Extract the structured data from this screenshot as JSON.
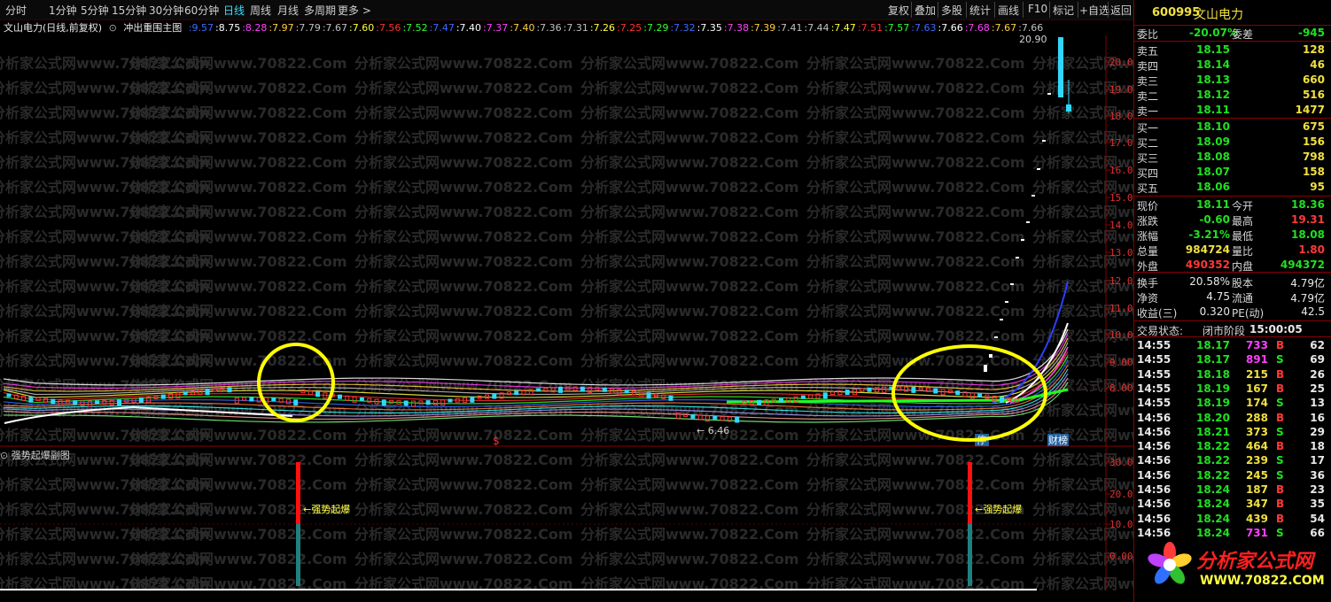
{
  "toolbar": {
    "periods": [
      "分时",
      "1分钟",
      "5分钟",
      "15分钟",
      "30分钟",
      "60分钟",
      "日线",
      "周线",
      "月线",
      "多周期",
      "更多 >"
    ],
    "active_period": "日线",
    "tools": [
      "复权",
      "叠加",
      "多股",
      "统计",
      "画线",
      "F10",
      "标记",
      "+自选",
      "返回"
    ]
  },
  "chart": {
    "stock_label": "文山电力(日线,前复权)",
    "main_indicator": "冲出重围主图",
    "ma_values": [
      {
        "v": "9.57",
        "c": "#3a6cff"
      },
      {
        "v": "8.75",
        "c": "#ffffff"
      },
      {
        "v": "8.28",
        "c": "#ff40ff"
      },
      {
        "v": "7.97",
        "c": "#ffd040"
      },
      {
        "v": "7.79",
        "c": "#c0c0c0"
      },
      {
        "v": "7.67",
        "c": "#c0c0c0"
      },
      {
        "v": "7.60",
        "c": "#ffff40"
      },
      {
        "v": "7.56",
        "c": "#ff3030"
      },
      {
        "v": "7.52",
        "c": "#30ff30"
      },
      {
        "v": "7.47",
        "c": "#3a6cff"
      },
      {
        "v": "7.40",
        "c": "#ffffff"
      },
      {
        "v": "7.37",
        "c": "#ff40ff"
      },
      {
        "v": "7.40",
        "c": "#ffd040"
      },
      {
        "v": "7.36",
        "c": "#c0c0c0"
      },
      {
        "v": "7.31",
        "c": "#c0c0c0"
      },
      {
        "v": "7.26",
        "c": "#ffff40"
      },
      {
        "v": "7.25",
        "c": "#ff3030"
      },
      {
        "v": "7.29",
        "c": "#30ff30"
      },
      {
        "v": "7.32",
        "c": "#3a6cff"
      },
      {
        "v": "7.35",
        "c": "#ffffff"
      },
      {
        "v": "7.38",
        "c": "#ff40ff"
      },
      {
        "v": "7.39",
        "c": "#ffd040"
      },
      {
        "v": "7.41",
        "c": "#c0c0c0"
      },
      {
        "v": "7.44",
        "c": "#c0c0c0"
      },
      {
        "v": "7.47",
        "c": "#ffff40"
      },
      {
        "v": "7.51",
        "c": "#ff3030"
      },
      {
        "v": "7.57",
        "c": "#30ff30"
      },
      {
        "v": "7.63",
        "c": "#3a6cff"
      },
      {
        "v": "7.66",
        "c": "#ffffff"
      },
      {
        "v": "7.68",
        "c": "#ff40ff"
      },
      {
        "v": "7.67",
        "c": "#ffd040"
      },
      {
        "v": "7.66",
        "c": "#c0c0c0"
      }
    ],
    "y_ticks": [
      "20.00",
      "19.00",
      "18.00",
      "17.00",
      "16.00",
      "15.00",
      "14.00",
      "13.00",
      "12.00",
      "11.00",
      "10.00",
      "9.00",
      "8.00"
    ],
    "high_label": "20.90",
    "low_label": "← 6.46",
    "marker_s": "$",
    "badge_left": "停",
    "badge_right": "财榜",
    "watermark": "分析家公式网www.70822.Com"
  },
  "sub_chart": {
    "title": "强势起爆副图",
    "y_ticks": [
      "30.00",
      "20.00",
      "10.00",
      "0.00"
    ],
    "signal_label": "←强势起爆"
  },
  "panel": {
    "code": "600995",
    "name": "文山电力",
    "weibi_label": "委比",
    "weibi_value": "-20.07%",
    "weicha_label": "委差",
    "weicha_value": "-945",
    "sells": [
      {
        "label": "卖五",
        "price": "18.15",
        "vol": "128"
      },
      {
        "label": "卖四",
        "price": "18.14",
        "vol": "46"
      },
      {
        "label": "卖三",
        "price": "18.13",
        "vol": "660"
      },
      {
        "label": "卖二",
        "price": "18.12",
        "vol": "516"
      },
      {
        "label": "卖一",
        "price": "18.11",
        "vol": "1477"
      }
    ],
    "buys": [
      {
        "label": "买一",
        "price": "18.10",
        "vol": "675"
      },
      {
        "label": "买二",
        "price": "18.09",
        "vol": "156"
      },
      {
        "label": "买三",
        "price": "18.08",
        "vol": "798"
      },
      {
        "label": "买四",
        "price": "18.07",
        "vol": "158"
      },
      {
        "label": "买五",
        "price": "18.06",
        "vol": "95"
      }
    ],
    "quote": [
      {
        "l1": "现价",
        "v1": "18.11",
        "c1": "green",
        "l2": "今开",
        "v2": "18.36",
        "c2": "green"
      },
      {
        "l1": "涨跌",
        "v1": "-0.60",
        "c1": "green",
        "l2": "最高",
        "v2": "19.31",
        "c2": "red"
      },
      {
        "l1": "涨幅",
        "v1": "-3.21%",
        "c1": "green",
        "l2": "最低",
        "v2": "18.08",
        "c2": "green"
      },
      {
        "l1": "总量",
        "v1": "984724",
        "c1": "yellow",
        "l2": "量比",
        "v2": "1.80",
        "c2": "red"
      },
      {
        "l1": "外盘",
        "v1": "490352",
        "c1": "red",
        "l2": "内盘",
        "v2": "494372",
        "c2": "green"
      }
    ],
    "fin": [
      {
        "l1": "换手",
        "v1": "20.58%",
        "l2": "股本",
        "v2": "4.79亿"
      },
      {
        "l1": "净资",
        "v1": "4.75",
        "l2": "流通",
        "v2": "4.79亿"
      },
      {
        "l1": "收益(三)",
        "v1": "0.320",
        "l2": "PE(动)",
        "v2": "42.5"
      }
    ],
    "status_label": "交易状态:",
    "status_value": "闭市阶段",
    "status_time": "15:00:05",
    "ticks": [
      {
        "t": "14:55",
        "p": "18.17",
        "v": "733",
        "s": "B",
        "n": "62",
        "vc": "mag"
      },
      {
        "t": "14:55",
        "p": "18.17",
        "v": "891",
        "s": "S",
        "n": "69",
        "vc": "mag"
      },
      {
        "t": "14:55",
        "p": "18.18",
        "v": "215",
        "s": "B",
        "n": "26",
        "vc": "yellow"
      },
      {
        "t": "14:55",
        "p": "18.19",
        "v": "167",
        "s": "B",
        "n": "25",
        "vc": "yellow"
      },
      {
        "t": "14:55",
        "p": "18.19",
        "v": "174",
        "s": "S",
        "n": "13",
        "vc": "yellow"
      },
      {
        "t": "14:56",
        "p": "18.20",
        "v": "288",
        "s": "B",
        "n": "16",
        "vc": "yellow"
      },
      {
        "t": "14:56",
        "p": "18.21",
        "v": "373",
        "s": "S",
        "n": "29",
        "vc": "yellow"
      },
      {
        "t": "14:56",
        "p": "18.22",
        "v": "464",
        "s": "B",
        "n": "18",
        "vc": "yellow"
      },
      {
        "t": "14:56",
        "p": "18.22",
        "v": "239",
        "s": "S",
        "n": "17",
        "vc": "yellow"
      },
      {
        "t": "14:56",
        "p": "18.22",
        "v": "245",
        "s": "S",
        "n": "36",
        "vc": "yellow"
      },
      {
        "t": "14:56",
        "p": "18.24",
        "v": "187",
        "s": "B",
        "n": "23",
        "vc": "yellow"
      },
      {
        "t": "14:56",
        "p": "18.24",
        "v": "347",
        "s": "B",
        "n": "35",
        "vc": "yellow"
      },
      {
        "t": "14:56",
        "p": "18.24",
        "v": "439",
        "s": "B",
        "n": "54",
        "vc": "yellow"
      },
      {
        "t": "14:56",
        "p": "18.24",
        "v": "731",
        "s": "S",
        "n": "66",
        "vc": "mag"
      }
    ]
  },
  "logo": {
    "text": "分析家公式网",
    "url": "WWW.70822.COM"
  },
  "colors": {
    "grid_red": "#8a0000",
    "up": "#ff3838",
    "down": "#30d8ff",
    "highlight": "#ffff00"
  }
}
